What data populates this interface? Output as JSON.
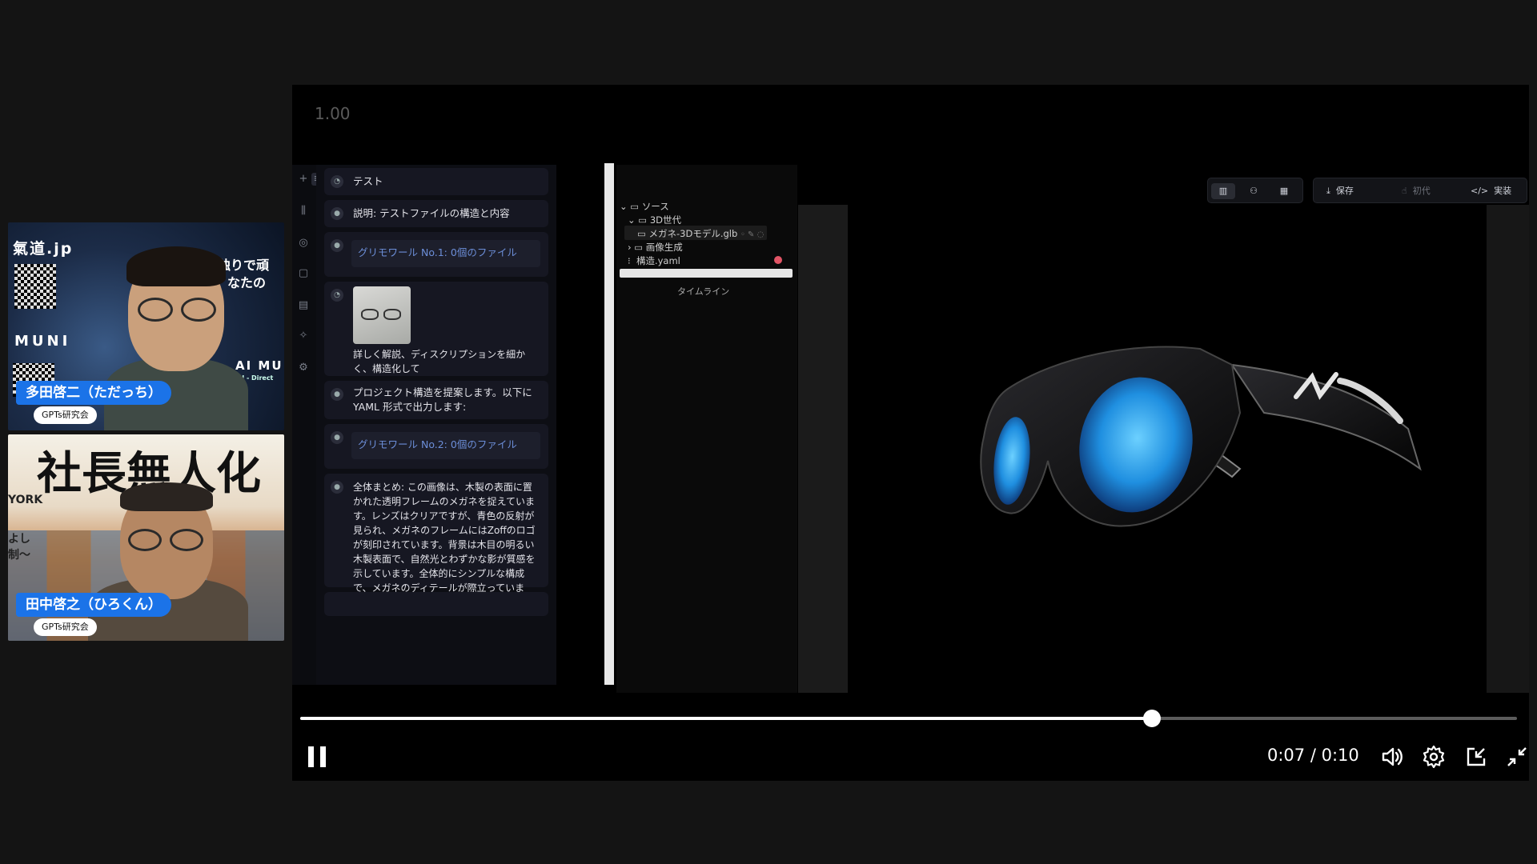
{
  "participants": [
    {
      "name": "多田啓二（ただっち）",
      "badge": "GPTs研究会",
      "background_texts": [
        "氣道.jp",
        "独りで頑",
        "なたの",
        "MUNI",
        "AI MU",
        "AI - Direct"
      ]
    },
    {
      "name": "田中啓之（ひろくん）",
      "badge": "GPTs研究会",
      "background_texts": [
        "社長無人化",
        "YORK",
        "よし",
        "制〜"
      ]
    }
  ],
  "player": {
    "zoom_label": "1.00",
    "time_display": "0:07 / 0:10",
    "progress_fraction": 0.7,
    "state": "playing",
    "icons": [
      "pause-icon",
      "volume-icon",
      "settings-icon",
      "miniplayer-icon",
      "exit-fullscreen-icon"
    ]
  },
  "app": {
    "chat_title": "テスト",
    "messages": [
      {
        "text": "説明: テストファイルの構造と内容"
      },
      {
        "link": "グリモワール No.1: 0個のファイル"
      },
      {
        "text": "詳しく解説、ディスクリプションを細かく、構造化して",
        "has_image": true
      },
      {
        "text": "プロジェクト構造を提案します。以下に YAML 形式で出力します:"
      },
      {
        "link": "グリモワール No.2: 0個のファイル"
      },
      {
        "text": "全体まとめ: この画像は、木製の表面に置かれた透明フレームのメガネを捉えています。レンズはクリアですが、青色の反射が見られ、メガネのフレームにはZoffのロゴが刻印されています。背景は木目の明るい木製表面で、自然光とわずかな影が質感を示しています。全体的にシンプルな構成で、メガネのディテールが際立っています。"
      }
    ],
    "tree": {
      "root": "ソース",
      "items": [
        "3D世代",
        "メガネ-3Dモデル.glb",
        "画像生成",
        "構造.yaml"
      ],
      "timeline_label": "タイムライン"
    },
    "toolbar": {
      "save": "保存",
      "generation": "初代",
      "implement": "実装"
    },
    "colors": {
      "accent_blue": "#1b73e8",
      "link_blue": "#6c8ed8",
      "lens_blue": "#1f8fe0"
    }
  }
}
